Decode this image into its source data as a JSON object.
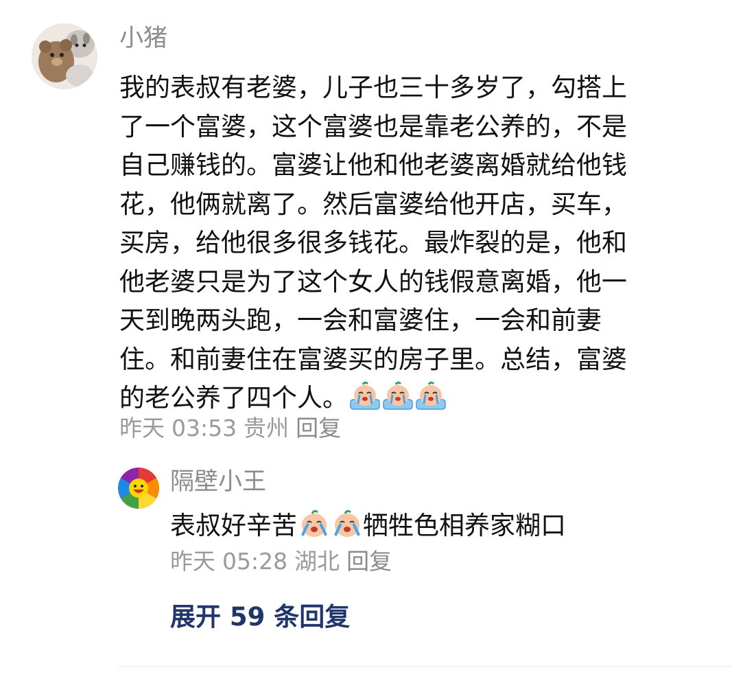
{
  "comment": {
    "username": "小猪",
    "content_lines": [
      "我的表叔有老婆，儿子也三十多岁了，勾搭上",
      "了一个富婆，这个富婆也是靠老公养的，不是",
      "自己赚钱的。富婆让他和他老婆离婚就给他钱",
      "花，他俩就离了。然后富婆给他开店，买车，",
      "买房，给他很多很多钱花。最炸裂的是，他和",
      "他老婆只是为了这个女人的钱假意离婚，他一",
      "天到晚两头跑，一会和富婆住，一会和前妻",
      "住。和前妻住在富婆买的房子里。总结，富婆",
      "的老公养了四个人。"
    ],
    "emoji_icons": [
      "crying-emoji-icon",
      "crying-emoji-icon",
      "crying-emoji-icon"
    ],
    "meta": {
      "date": "昨天",
      "time": "03:53",
      "location": "贵州",
      "reply_label": "回复"
    }
  },
  "reply": {
    "username": "隔壁小王",
    "content_before": "表叔好辛苦",
    "emoji_icons": [
      "crying-emoji-icon",
      "crying-emoji-icon"
    ],
    "content_after": "牺牲色相养家糊口",
    "meta": {
      "date": "昨天",
      "time": "05:28",
      "location": "湖北",
      "reply_label": "回复"
    }
  },
  "expand_label": "展开 59 条回复",
  "colors": {
    "text_primary": "#111111",
    "text_secondary": "#9a9a9a",
    "link_accent": "#20366b"
  }
}
